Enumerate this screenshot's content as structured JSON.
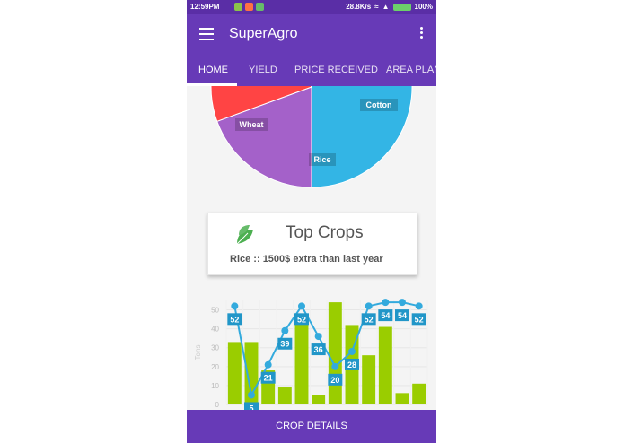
{
  "status_bar": {
    "time": "12:59PM",
    "speed": "28.8K/s",
    "battery": "100%"
  },
  "app_bar": {
    "title": "SuperAgro",
    "menu_icon": "hamburger-menu-icon",
    "overflow_icon": "more-vert-icon"
  },
  "tabs": [
    {
      "label": "HOME",
      "active": true
    },
    {
      "label": "YIELD",
      "active": false
    },
    {
      "label": "PRICE RECEIVED",
      "active": false
    },
    {
      "label": "AREA PLAN",
      "active": false
    }
  ],
  "top_crops_card": {
    "icon": "leaf-icon",
    "title": "Top Crops",
    "crop": "Rice",
    "info": " :: 1500$ extra than last year"
  },
  "footer": {
    "button_label": "CROP DETAILS"
  },
  "colors": {
    "primary": "#673ab7",
    "status_bar": "#5a2ea6",
    "bar_green": "#9acd00",
    "line_blue": "#33aadd"
  },
  "chart_data": [
    {
      "type": "pie",
      "labels": [
        "Wheat",
        "Rice",
        "Cotton"
      ],
      "colors": [
        "#a461c9",
        "#ff4444",
        "#33b5e5"
      ]
    },
    {
      "type": "bar",
      "ylabel": "Tons",
      "ylim": [
        0,
        55
      ],
      "yticks": [
        0,
        10,
        20,
        30,
        40,
        50
      ],
      "grid": true,
      "series": [
        {
          "kind": "bar",
          "values": [
            33,
            33,
            18,
            9,
            44,
            5,
            54,
            42,
            26,
            41,
            6,
            11
          ]
        },
        {
          "kind": "line",
          "values": [
            52,
            5,
            21,
            39,
            52,
            36,
            20,
            28,
            52,
            54,
            54,
            52
          ]
        }
      ]
    }
  ]
}
